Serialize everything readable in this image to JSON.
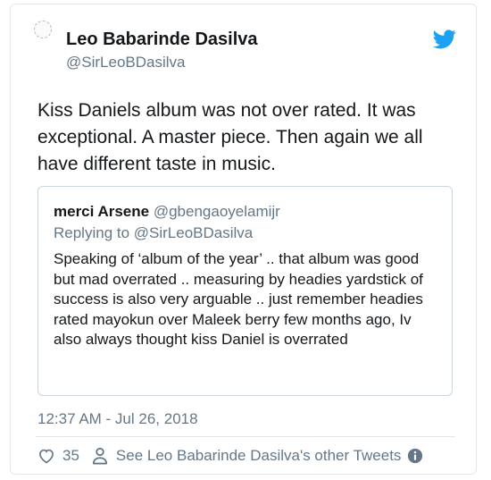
{
  "tweet": {
    "author_name": "Leo Babarinde Dasilva",
    "author_handle": "@SirLeoBDasilva",
    "text": "Kiss Daniels album was not over rated. It was exceptional. A master piece. Then again we all have different taste in music.",
    "timestamp": "12:37 AM - Jul 26, 2018",
    "likes": "35",
    "other_tweets_label": "See Leo Babarinde Dasilva's other Tweets"
  },
  "quoted": {
    "author_name": "merci Arsene",
    "author_handle": "@gbengaoyelamijr",
    "replying_to": "Replying to @SirLeoBDasilva",
    "text": "Speaking of ‘album of the year’ .. that album was good but mad overrated .. measuring by headies yardstick of success is also very arguable .. just remember headies rated mayokun over Maleek berry few months ago, Iv also always thought kiss Daniel is overrated"
  },
  "colors": {
    "twitter_blue": "#1da1f2",
    "secondary_text": "#657786",
    "border": "#e1e8ed"
  },
  "icons": {
    "brand": "twitter-bird-icon",
    "like": "heart-icon",
    "profile": "person-icon",
    "info": "info-icon"
  }
}
